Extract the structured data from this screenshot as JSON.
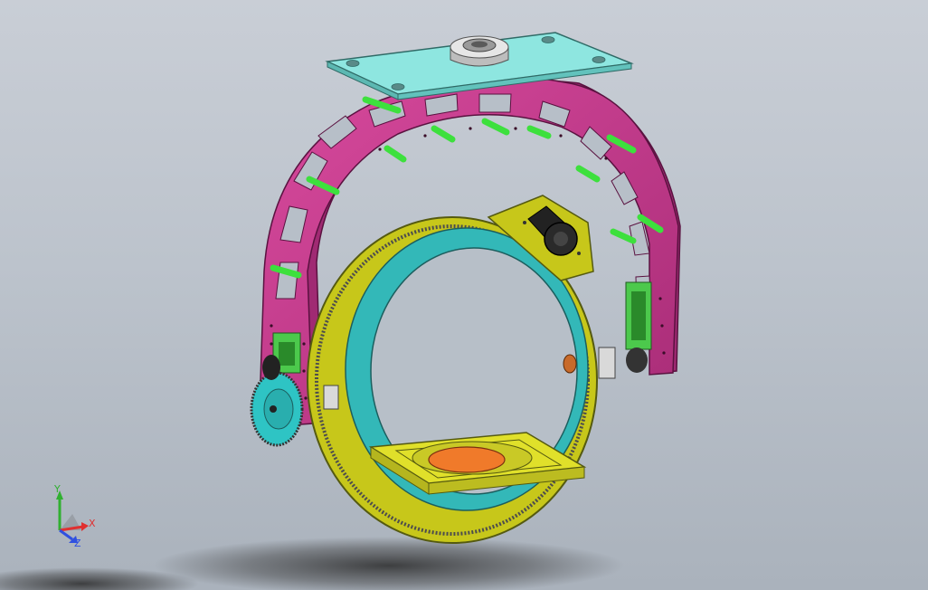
{
  "viewport": {
    "background_top": "#c9ced6",
    "background_bottom": "#aab2bc"
  },
  "model": {
    "colors": {
      "frame": "#c8378f",
      "frame_dark": "#8f2366",
      "rods": "#3de03d",
      "top_plate": "#8ee6e0",
      "bearing": "#d9d9d9",
      "outer_ring": "#c7c71a",
      "inner_ring": "#33b8b8",
      "gear_teeth": "#4d4d4d",
      "tray": "#e0e02a",
      "disc": "#f07a2a",
      "mount_bracket": "#4cc94c",
      "small_gear": "#2ec4c4",
      "motor": "#222222",
      "shadow": "#3a3a3a"
    }
  },
  "triad": {
    "x_label": "X",
    "y_label": "Y",
    "z_label": "Z",
    "x_color": "#e03030",
    "y_color": "#30b030",
    "z_color": "#3050e0"
  }
}
